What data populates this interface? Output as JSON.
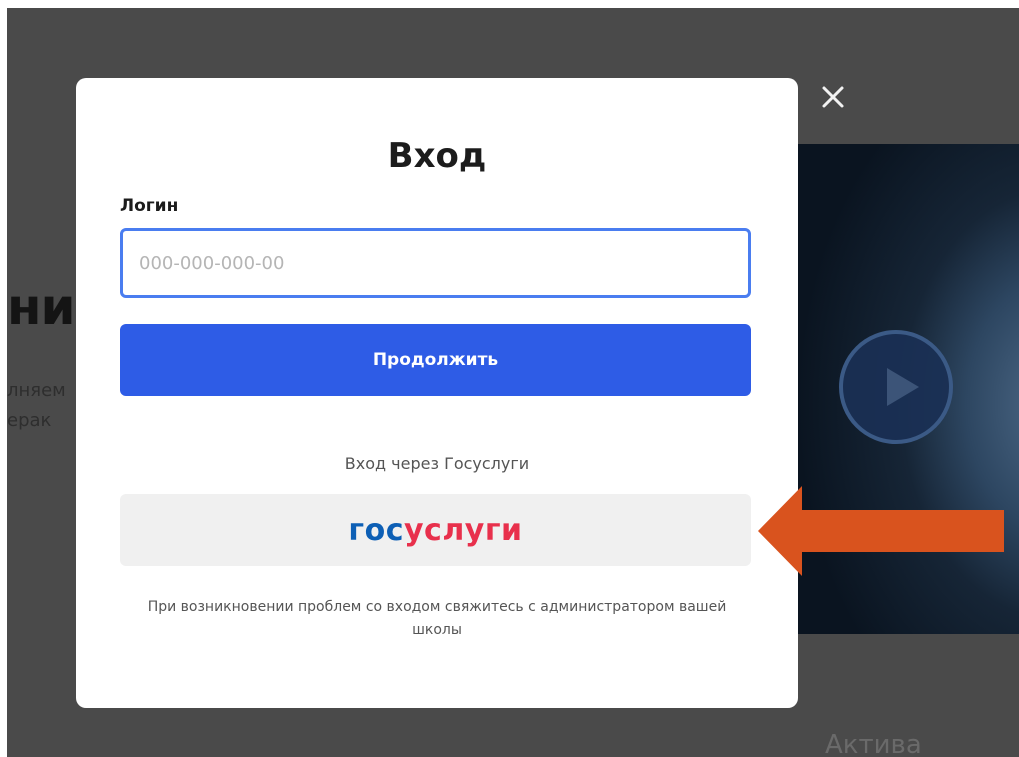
{
  "background": {
    "heading_fragment": "ник",
    "text_line_1": "лняем",
    "text_line_2": "ерак"
  },
  "modal": {
    "title": "Вход",
    "login_label": "Логин",
    "login_value": "",
    "login_placeholder": "000-000-000-00",
    "continue_label": "Продолжить",
    "gosuslugi_caption": "Вход через Госуслуги",
    "gosuslugi_logo_part1": "гос",
    "gosuslugi_logo_part2": "услуги",
    "footnote": "При возникновении проблем со входом свяжитесь с администратором вашей школы"
  },
  "overlay": {
    "activation_text": "Актива"
  },
  "colors": {
    "primary": "#2e5ce6",
    "input_focus": "#4a7df0",
    "gos_blue": "#0d5fb5",
    "gos_red": "#e8304c",
    "arrow": "#d9531e",
    "backdrop": "#4a4a4a"
  },
  "icons": {
    "close": "close-icon",
    "play": "play-icon",
    "arrow": "arrow-left-icon"
  }
}
